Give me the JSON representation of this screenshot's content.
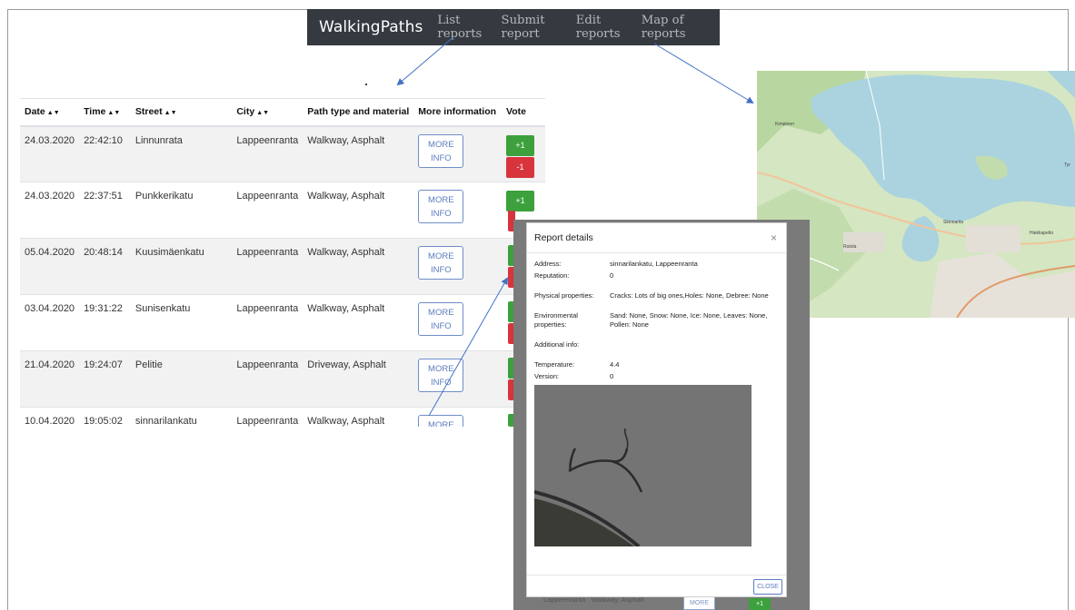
{
  "navbar": {
    "brand": "WalkingPaths",
    "links": [
      "List reports",
      "Submit report",
      "Edit reports",
      "Map of reports"
    ]
  },
  "table": {
    "columns": [
      "Date",
      "Time",
      "Street",
      "City",
      "Path type and material",
      "More information",
      "Vote"
    ],
    "rows": [
      {
        "date": "24.03.2020",
        "time": "22:42:10",
        "street": "Linnunrata",
        "city": "Lappeenranta",
        "path": "Walkway, Asphalt"
      },
      {
        "date": "24.03.2020",
        "time": "22:37:51",
        "street": "Punkkerikatu",
        "city": "Lappeenranta",
        "path": "Walkway, Asphalt"
      },
      {
        "date": "05.04.2020",
        "time": "20:48:14",
        "street": "Kuusimäenkatu",
        "city": "Lappeenranta",
        "path": "Walkway, Asphalt"
      },
      {
        "date": "03.04.2020",
        "time": "19:31:22",
        "street": "Sunisenkatu",
        "city": "Lappeenranta",
        "path": "Walkway, Asphalt"
      },
      {
        "date": "21.04.2020",
        "time": "19:24:07",
        "street": "Pelitie",
        "city": "Lappeenranta",
        "path": "Driveway, Asphalt"
      },
      {
        "date": "10.04.2020",
        "time": "19:05:02",
        "street": "sinnarilankatu",
        "city": "Lappeenranta",
        "path": "Walkway, Asphalt"
      }
    ],
    "more_line1": "MORE",
    "more_line2": "INFO",
    "vote_up": "+1",
    "vote_down": "-1"
  },
  "modal": {
    "title": "Report details",
    "close_x": "×",
    "address_label": "Address:",
    "address_value": "sinnarilankatu, Lappeenranta",
    "reputation_label": "Reputation:",
    "reputation_value": "0",
    "physical_label": "Physical properties:",
    "physical_value": "Cracks: Lots of big ones,Holes: None, Debree: None",
    "environmental_label": "Environmental properties:",
    "environmental_value": "Sand: None, Snow: None, Ice: None, Leaves: None, Pollen: None",
    "additional_label": "Additional info:",
    "temperature_label": "Temperature:",
    "temperature_value": "4.4",
    "version_label": "Version:",
    "version_value": "0",
    "close_button": "CLOSE"
  },
  "behind_modal": {
    "city": "Lappeenranta",
    "path": "Walkway, Asphalt",
    "more": "MORE",
    "vote": "+1"
  },
  "map": {
    "labels": [
      "Kimpinen",
      "Skinnarila",
      "Rutola",
      "Tyr",
      "Hiekkapelto"
    ]
  },
  "colors": {
    "navbar_bg": "#343a40",
    "vote_up": "#3ca13c",
    "vote_down": "#d7343e",
    "link_blue": "#5c7cbf"
  }
}
